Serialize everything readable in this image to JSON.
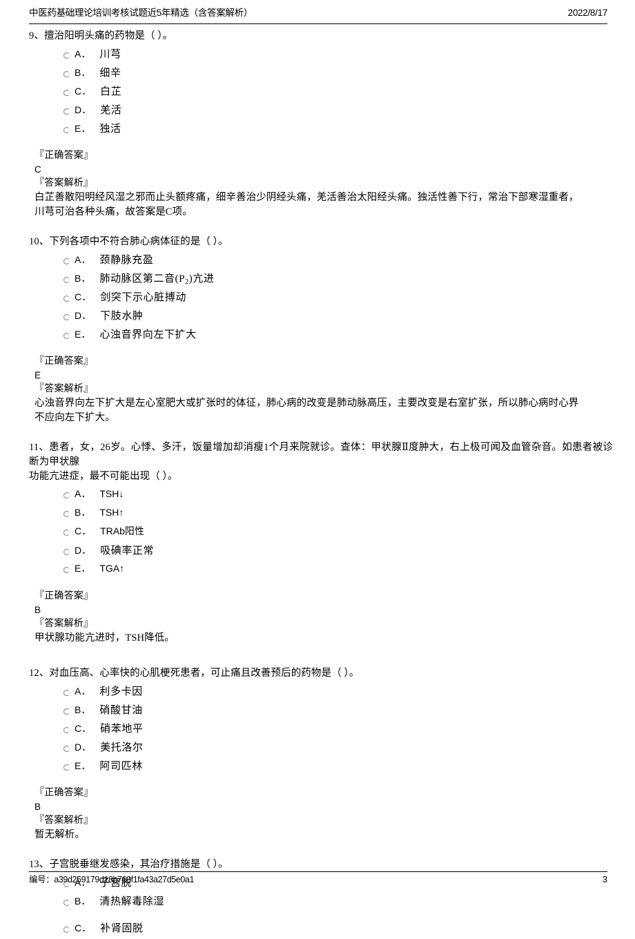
{
  "header": {
    "title": "中医药基础理论培训考核试题近5年精选（含答案解析）",
    "date": "2022/8/17"
  },
  "footer": {
    "id_label": "编号：",
    "id_value": "a39d259179d18b760f1fa43a27d5e0a1",
    "id_full": "编号：a39d259179d18b760f1fa43a27d5e0a1",
    "page_number": "3"
  },
  "labels": {
    "correct_answer": "『正确答案』",
    "answer_analysis": "『答案解析』"
  },
  "questions": [
    {
      "number": "9",
      "stem": "9、擅治阳明头痛的药物是（      ）。",
      "options": [
        {
          "letter": "A．",
          "text": "川芎"
        },
        {
          "letter": "B．",
          "text": "细辛"
        },
        {
          "letter": "C．",
          "text": "白芷"
        },
        {
          "letter": "D．",
          "text": "羌活"
        },
        {
          "letter": "E．",
          "text": "独活"
        }
      ],
      "answer": "C",
      "analysis_line1": "白芷善散阳明经风湿之邪而止头额疼痛，细辛善治少阴经头痛，羌活善治太阳经头痛。独活性善下行，常治下部寒湿重者，",
      "analysis_line2": "川芎可治各种头痛，故答案是C项。"
    },
    {
      "number": "10",
      "stem": "10、下列各项中不符合肺心病体征的是（      ）。",
      "options": [
        {
          "letter": "A．",
          "text": "颈静脉充盈"
        },
        {
          "letter": "B．",
          "text": "肺动脉区第二音(P2)亢进",
          "text_pre": "肺动脉区第二音(P",
          "sub": "2",
          "text_post": ")亢进"
        },
        {
          "letter": "C．",
          "text": "剑突下示心脏搏动"
        },
        {
          "letter": "D．",
          "text": "下肢水肿"
        },
        {
          "letter": "E．",
          "text": "心浊音界向左下扩大"
        }
      ],
      "answer": "E",
      "analysis_line1": "心浊音界向左下扩大是左心室肥大或扩张时的体征，肺心病的改变是肺动脉高压，主要改变是右室扩张，所以肺心病时心界",
      "analysis_line2": "不应向左下扩大。"
    },
    {
      "number": "11",
      "stem_line1": "11、患者，女，26岁。心悸、多汗，饭量增加却消瘦1个月来院就诊。查体：甲状腺Ⅱ度肿大，右上极可闻及血管杂音。如患者被诊断为甲状腺",
      "stem_line2": "功能亢进症，最不可能出现（      ）。",
      "options": [
        {
          "letter": "A．",
          "text": "TSH↓"
        },
        {
          "letter": "B．",
          "text": "TSH↑"
        },
        {
          "letter": "C．",
          "text": "TRAb阳性"
        },
        {
          "letter": "D．",
          "text": "吸碘率正常"
        },
        {
          "letter": "E．",
          "text": "TGA↑"
        }
      ],
      "answer": "B",
      "analysis_line1": "甲状腺功能亢进时，TSH降低。",
      "analysis_line2": ""
    },
    {
      "number": "12",
      "stem": "12、对血压高、心率快的心肌梗死患者，可止痛且改善预后的药物是（      ）。",
      "options": [
        {
          "letter": "A．",
          "text": "利多卡因"
        },
        {
          "letter": "B．",
          "text": "硝酸甘油"
        },
        {
          "letter": "C．",
          "text": "硝苯地平"
        },
        {
          "letter": "D．",
          "text": "美托洛尔"
        },
        {
          "letter": "E．",
          "text": "阿司匹林"
        }
      ],
      "answer": "B",
      "analysis_line1": "暂无解析。",
      "analysis_line2": ""
    },
    {
      "number": "13",
      "stem": "13、子宫脱垂继发感染，其治疗措施是（      ）。",
      "options": [
        {
          "letter": "A．",
          "text": "子宫脱"
        },
        {
          "letter": "B．",
          "text": "清热解毒除湿"
        },
        {
          "letter": "C．",
          "text": "补肾固脱"
        }
      ]
    }
  ]
}
